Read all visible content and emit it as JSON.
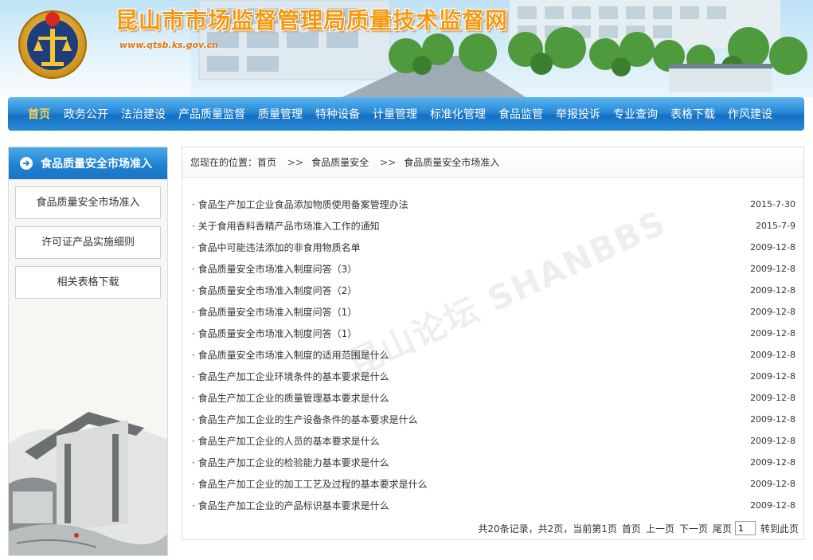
{
  "header": {
    "site_title": "昆山市市场监督管理局质量技术监督网",
    "site_url": "www.qtsb.ks.gov.cn"
  },
  "nav": {
    "items": [
      "首页",
      "政务公开",
      "法治建设",
      "产品质量监督",
      "质量管理",
      "特种设备",
      "计量管理",
      "标准化管理",
      "食品监管",
      "举报投诉",
      "专业查询",
      "表格下载",
      "作风建设"
    ],
    "active_index": 0,
    "active_color": "#ffd34a"
  },
  "sidebar": {
    "heading": "食品质量安全市场准入",
    "items": [
      "食品质量安全市场准入",
      "许可证产品实施细则",
      "相关表格下载"
    ]
  },
  "breadcrumb": {
    "prefix": "您现在的位置：",
    "items": [
      "首页",
      "食品质量安全",
      "食品质量安全市场准入"
    ],
    "separator": ">>"
  },
  "articles": [
    {
      "title": "· 食品生产加工企业食品添加物质使用备案管理办法",
      "date": "2015-7-30"
    },
    {
      "title": "· 关于食用香料香精产品市场准入工作的通知",
      "date": "2015-7-9"
    },
    {
      "title": "· 食品中可能违法添加的非食用物质名单",
      "date": "2009-12-8"
    },
    {
      "title": "· 食品质量安全市场准入制度问答（3）",
      "date": "2009-12-8"
    },
    {
      "title": "· 食品质量安全市场准入制度问答（2）",
      "date": "2009-12-8"
    },
    {
      "title": "· 食品质量安全市场准入制度问答（1）",
      "date": "2009-12-8"
    },
    {
      "title": "· 食品质量安全市场准入制度问答（1）",
      "date": "2009-12-8"
    },
    {
      "title": "· 食品质量安全市场准入制度的适用范围是什么",
      "date": "2009-12-8"
    },
    {
      "title": "· 食品生产加工企业环境条件的基本要求是什么",
      "date": "2009-12-8"
    },
    {
      "title": "· 食品生产加工企业的质量管理基本要求是什么",
      "date": "2009-12-8"
    },
    {
      "title": "· 食品生产加工企业的生产设备条件的基本要求是什么",
      "date": "2009-12-8"
    },
    {
      "title": "· 食品生产加工企业的人员的基本要求是什么",
      "date": "2009-12-8"
    },
    {
      "title": "· 食品生产加工企业的检验能力基本要求是什么",
      "date": "2009-12-8"
    },
    {
      "title": "· 食品生产加工企业的加工工艺及过程的基本要求是什么",
      "date": "2009-12-8"
    },
    {
      "title": "· 食品生产加工企业的产品标识基本要求是什么",
      "date": "2009-12-8"
    }
  ],
  "pager": {
    "summary": "共20条记录，共2页，当前第1页",
    "first": "首页",
    "prev": "上一页",
    "next": "下一页",
    "last": "尾页",
    "page_value": "1",
    "go": "转到此页"
  },
  "watermark": "昆山论坛 SHANBBS"
}
